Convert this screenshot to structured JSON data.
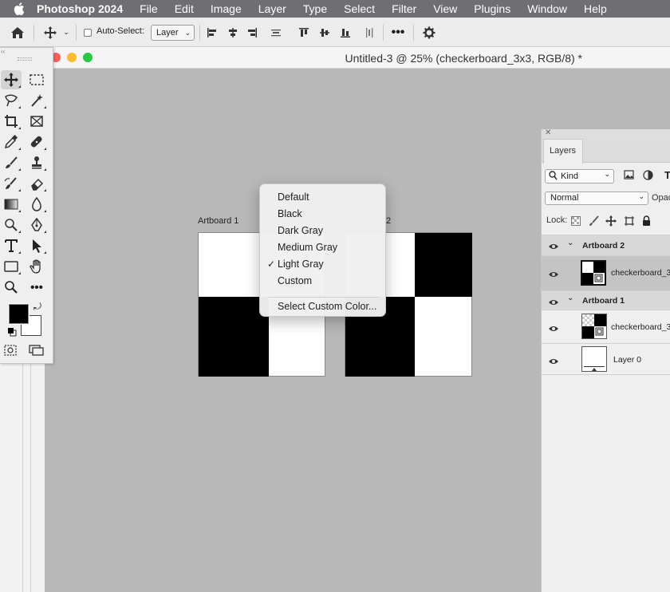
{
  "menubar": {
    "app_name": "Photoshop 2024",
    "items": [
      "File",
      "Edit",
      "Image",
      "Layer",
      "Type",
      "Select",
      "Filter",
      "View",
      "Plugins",
      "Window",
      "Help"
    ]
  },
  "options_bar": {
    "auto_select_label": "Auto-Select:",
    "auto_select_checked": false,
    "target_value": "Layer"
  },
  "document": {
    "title": "Untitled-3 @ 25% (checkerboard_3x3, RGB/8) *"
  },
  "canvas": {
    "artboard1_label": "Artboard 1",
    "artboard2_label_suffix": "2"
  },
  "popup_menu": {
    "items": [
      "Default",
      "Black",
      "Dark Gray",
      "Medium Gray",
      "Light Gray",
      "Custom"
    ],
    "checked_item": "Light Gray",
    "check_mark": "✓",
    "custom_color_label": "Select Custom Color..."
  },
  "layers_panel": {
    "tab_label": "Layers",
    "kind_label": "Kind",
    "blend_mode": "Normal",
    "opacity_label": "Opac",
    "lock_label": "Lock:",
    "rows": [
      {
        "type": "group",
        "name": "Artboard 2"
      },
      {
        "type": "layer",
        "name": "checkerboard_3",
        "selected": true
      },
      {
        "type": "group",
        "name": "Artboard 1"
      },
      {
        "type": "layer",
        "name": "checkerboard_3"
      },
      {
        "type": "layer",
        "name": "Layer 0"
      }
    ]
  },
  "colors": {
    "menubar_bg": "#6f6f73",
    "workspace_bg": "#b8b8b8",
    "foreground": "#000000",
    "background": "#ffffff"
  }
}
